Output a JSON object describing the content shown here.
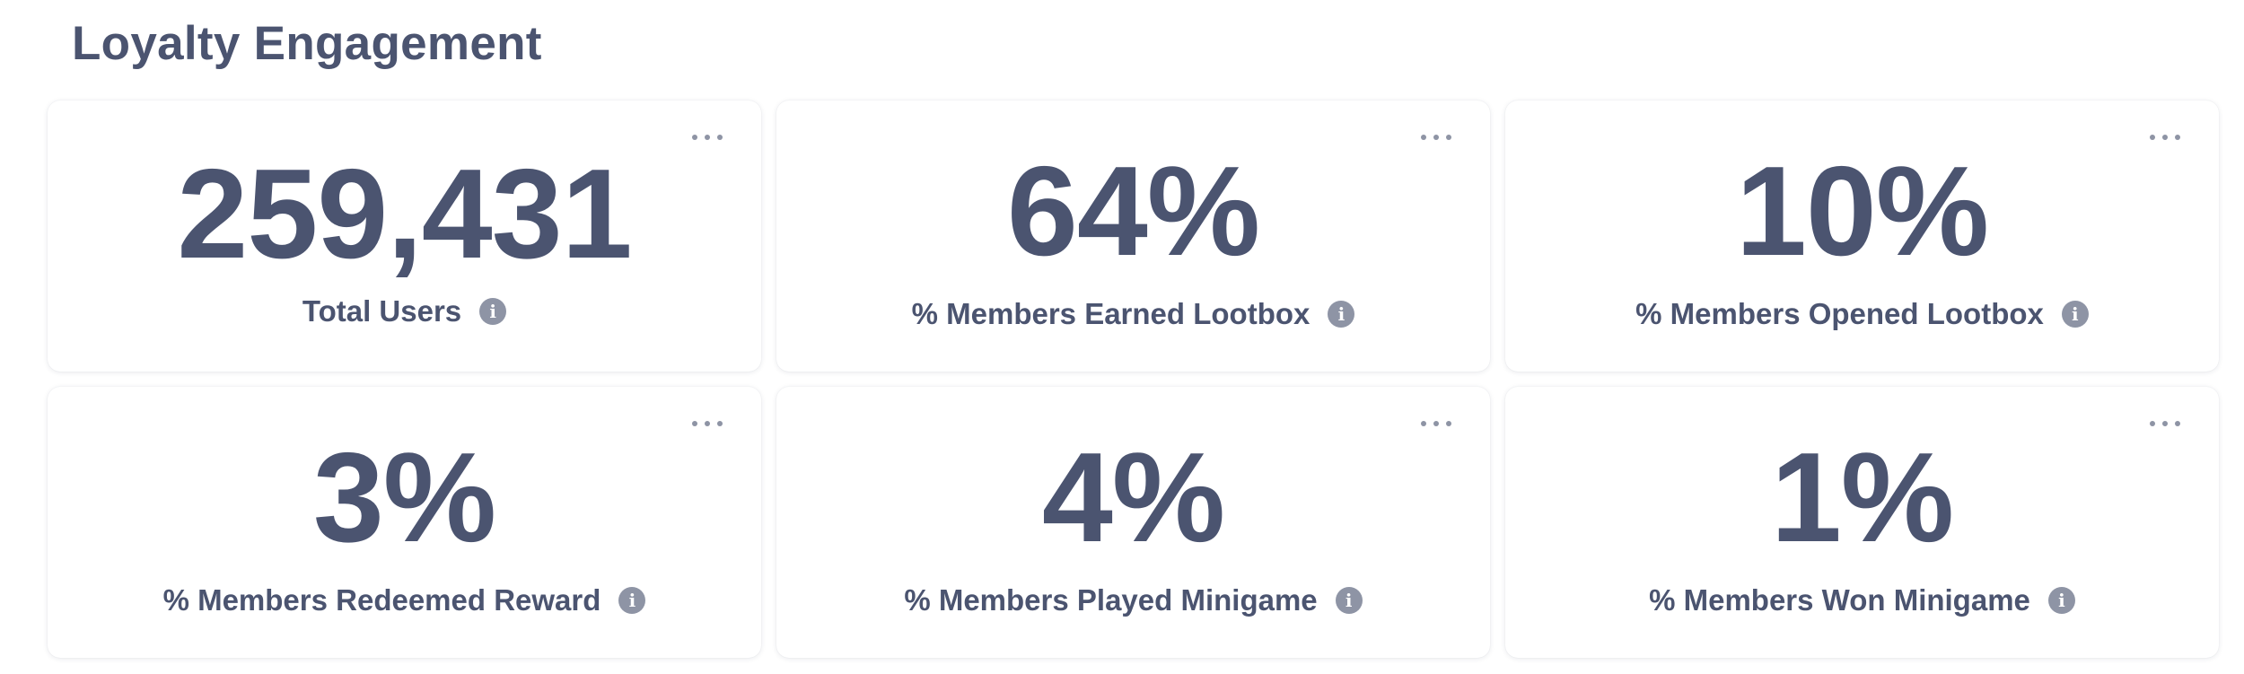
{
  "section": {
    "title": "Loyalty Engagement"
  },
  "cards": [
    {
      "value": "259,431",
      "label": "Total Users",
      "menu_icon": "more-horizontal-icon",
      "info_icon": "info-icon"
    },
    {
      "value": "64%",
      "label": "% Members Earned Lootbox",
      "menu_icon": "more-horizontal-icon",
      "info_icon": "info-icon"
    },
    {
      "value": "10%",
      "label": "% Members Opened Lootbox",
      "menu_icon": "more-horizontal-icon",
      "info_icon": "info-icon"
    },
    {
      "value": "3%",
      "label": "% Members Redeemed Reward",
      "menu_icon": "more-horizontal-icon",
      "info_icon": "info-icon"
    },
    {
      "value": "4%",
      "label": "% Members Played Minigame",
      "menu_icon": "more-horizontal-icon",
      "info_icon": "info-icon"
    },
    {
      "value": "1%",
      "label": "% Members Won Minigame",
      "menu_icon": "more-horizontal-icon",
      "info_icon": "info-icon"
    }
  ],
  "colors": {
    "text": "#4b5470",
    "icon": "#8e94a5",
    "card_bg": "#ffffff"
  }
}
